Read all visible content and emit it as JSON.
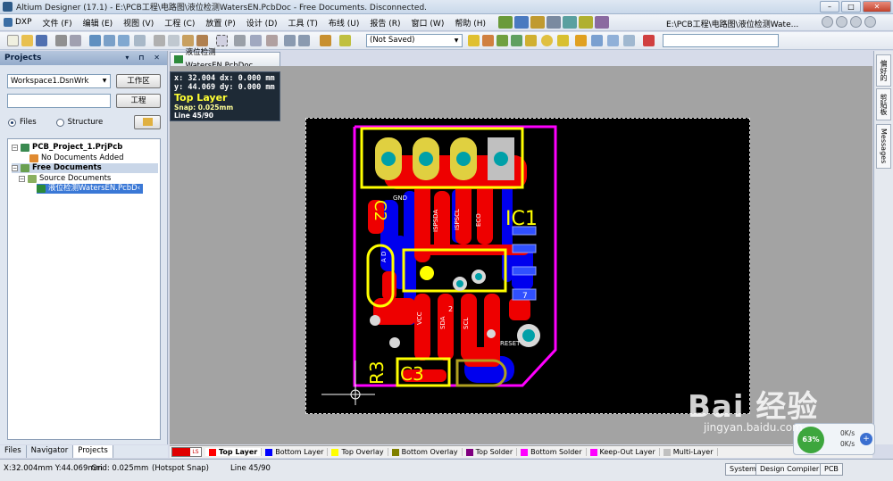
{
  "window": {
    "title": "Altium Designer (17.1) - E:\\PCB工程\\电路图\\液位检测WatersEN.PcbDoc - Free Documents. Disconnected.",
    "path_label": "E:\\PCB工程\\电路图\\液位检测Wate..."
  },
  "menu": {
    "dxp": "DXP",
    "items": [
      "文件 (F)",
      "编辑 (E)",
      "视图 (V)",
      "工程 (C)",
      "放置 (P)",
      "设计 (D)",
      "工具 (T)",
      "布线 (U)",
      "报告 (R)",
      "窗口 (W)",
      "帮助 (H)"
    ]
  },
  "toolbar": {
    "saved_status": "(Not Saved)"
  },
  "projects_panel": {
    "title": "Projects",
    "workspace": "Workspace1.DsnWrk",
    "workspace_button": "工作区",
    "project_button": "工程",
    "radio_files": "Files",
    "radio_structure": "Structure",
    "tree": {
      "project": "PCB_Project_1.PrjPcb",
      "no_docs": "No Documents Added",
      "free_docs": "Free Documents",
      "source_docs": "Source Documents",
      "pcb_doc": "液位检测WatersEN.PcbD‹"
    }
  },
  "panel_tabs": [
    "Files",
    "Navigator",
    "Projects"
  ],
  "document_tab": "液位检测WatersEN.PcbDoc",
  "hud": {
    "line1": "x: 32.004   dx:  0.000 mm",
    "line2": "y: 44.069   dy:  0.000 mm",
    "layer": "Top Layer",
    "snap": "Snap: 0.025mm",
    "line": "Line 45/90"
  },
  "pcb": {
    "designators": {
      "c2": "C2",
      "ic1": "IC1",
      "r3": "R3",
      "c3": "C3"
    },
    "pad_labels": {
      "gnd": "GND",
      "ispsda": "ISPSDA",
      "ispscl": "ISPSCL",
      "eco": "ECO",
      "reset": "RESET",
      "vcc": "VCC",
      "pin7": "7",
      "pin2": "2",
      "sda": "SDA",
      "scl": "SCL",
      "ad": "A D"
    }
  },
  "right_tabs": [
    "偏好的",
    "剪贴板",
    "Messages"
  ],
  "layer_tabs": {
    "ls": "LS",
    "layers": [
      {
        "name": "Top Layer",
        "color": "#ff0000"
      },
      {
        "name": "Bottom Layer",
        "color": "#0000ff"
      },
      {
        "name": "Top Overlay",
        "color": "#ffff00"
      },
      {
        "name": "Bottom Overlay",
        "color": "#808000"
      },
      {
        "name": "Top Solder",
        "color": "#800080"
      },
      {
        "name": "Bottom Solder",
        "color": "#ff00ff"
      },
      {
        "name": "Keep-Out Layer",
        "color": "#ff00ff"
      },
      {
        "name": "Multi-Layer",
        "color": "#c0c0c0"
      }
    ]
  },
  "status": {
    "coords": "X:32.004mm Y:44.069mm",
    "grid": "Grid: 0.025mm",
    "hotspot": "(Hotspot Snap)",
    "line": "Line 45/90",
    "system": "System",
    "design_compiler": "Design Compiler",
    "pcb": "PCB"
  },
  "net_widget": {
    "percent": "63%",
    "up": "0K/s",
    "down": "0K/s",
    "plus": "+"
  },
  "watermark": {
    "brand": "Bai 经验",
    "url": "jingyan.baidu.com"
  },
  "colors": {
    "top_layer": "#ff0000",
    "bottom_layer": "#0000ff",
    "overlay": "#ffff00",
    "keepout": "#ff00ff",
    "pad": "#00a0a8"
  }
}
